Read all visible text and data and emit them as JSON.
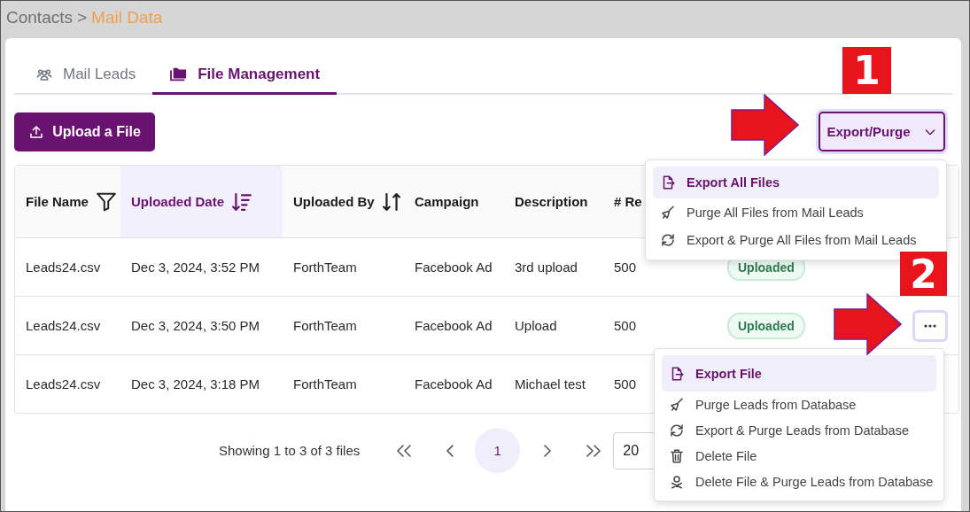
{
  "breadcrumb": {
    "parent": "Contacts",
    "separator": ">",
    "current": "Mail Data"
  },
  "tabs": [
    {
      "label": "Mail Leads",
      "selected": false
    },
    {
      "label": "File Management",
      "selected": true
    }
  ],
  "upload_button": "Upload a File",
  "export_button": {
    "label": "Export/Purge",
    "expanded": true
  },
  "table": {
    "columns": [
      {
        "label": "File Name",
        "filter": true,
        "active": false
      },
      {
        "label": "Uploaded Date",
        "sortable": true,
        "active": true
      },
      {
        "label": "Uploaded By",
        "sortable": true,
        "active": false
      },
      {
        "label": "Campaign",
        "active": false
      },
      {
        "label": "Description",
        "active": false
      },
      {
        "label": "# Re",
        "active": false
      }
    ],
    "rows": [
      {
        "cells": [
          "Leads24.csv",
          "Dec 3, 2024, 3:52 PM",
          "ForthTeam",
          "Facebook Ad",
          "3rd upload",
          "500"
        ],
        "status": "Uploaded"
      },
      {
        "cells": [
          "Leads24.csv",
          "Dec 3, 2024, 3:50 PM",
          "ForthTeam",
          "Facebook Ad",
          "Upload",
          "500"
        ],
        "status": "Uploaded",
        "actions_button": true
      },
      {
        "cells": [
          "Leads24.csv",
          "Dec 3, 2024, 3:18 PM",
          "ForthTeam",
          "Facebook Ad",
          "Michael test",
          "500"
        ]
      }
    ]
  },
  "pagination": {
    "summary": "Showing 1 to 3 of 3 files",
    "pages": [
      {
        "label": "1",
        "selected": true
      }
    ],
    "page_size": "20"
  },
  "export_menu": [
    {
      "label": "Export All Files",
      "selected": true
    },
    {
      "label": "Purge All Files from Mail Leads",
      "selected": false
    },
    {
      "label": "Export & Purge All Files from Mail Leads",
      "selected": false
    }
  ],
  "row_menu": [
    {
      "label": "Export File",
      "selected": true
    },
    {
      "label": "Purge Leads from Database",
      "selected": false
    },
    {
      "label": "Export & Purge Leads from Database",
      "selected": false
    },
    {
      "label": "Delete File",
      "selected": false
    },
    {
      "label": "Delete File & Purge Leads from Database",
      "selected": false
    }
  ],
  "callouts": [
    {
      "label": "1"
    },
    {
      "label": "2"
    }
  ]
}
